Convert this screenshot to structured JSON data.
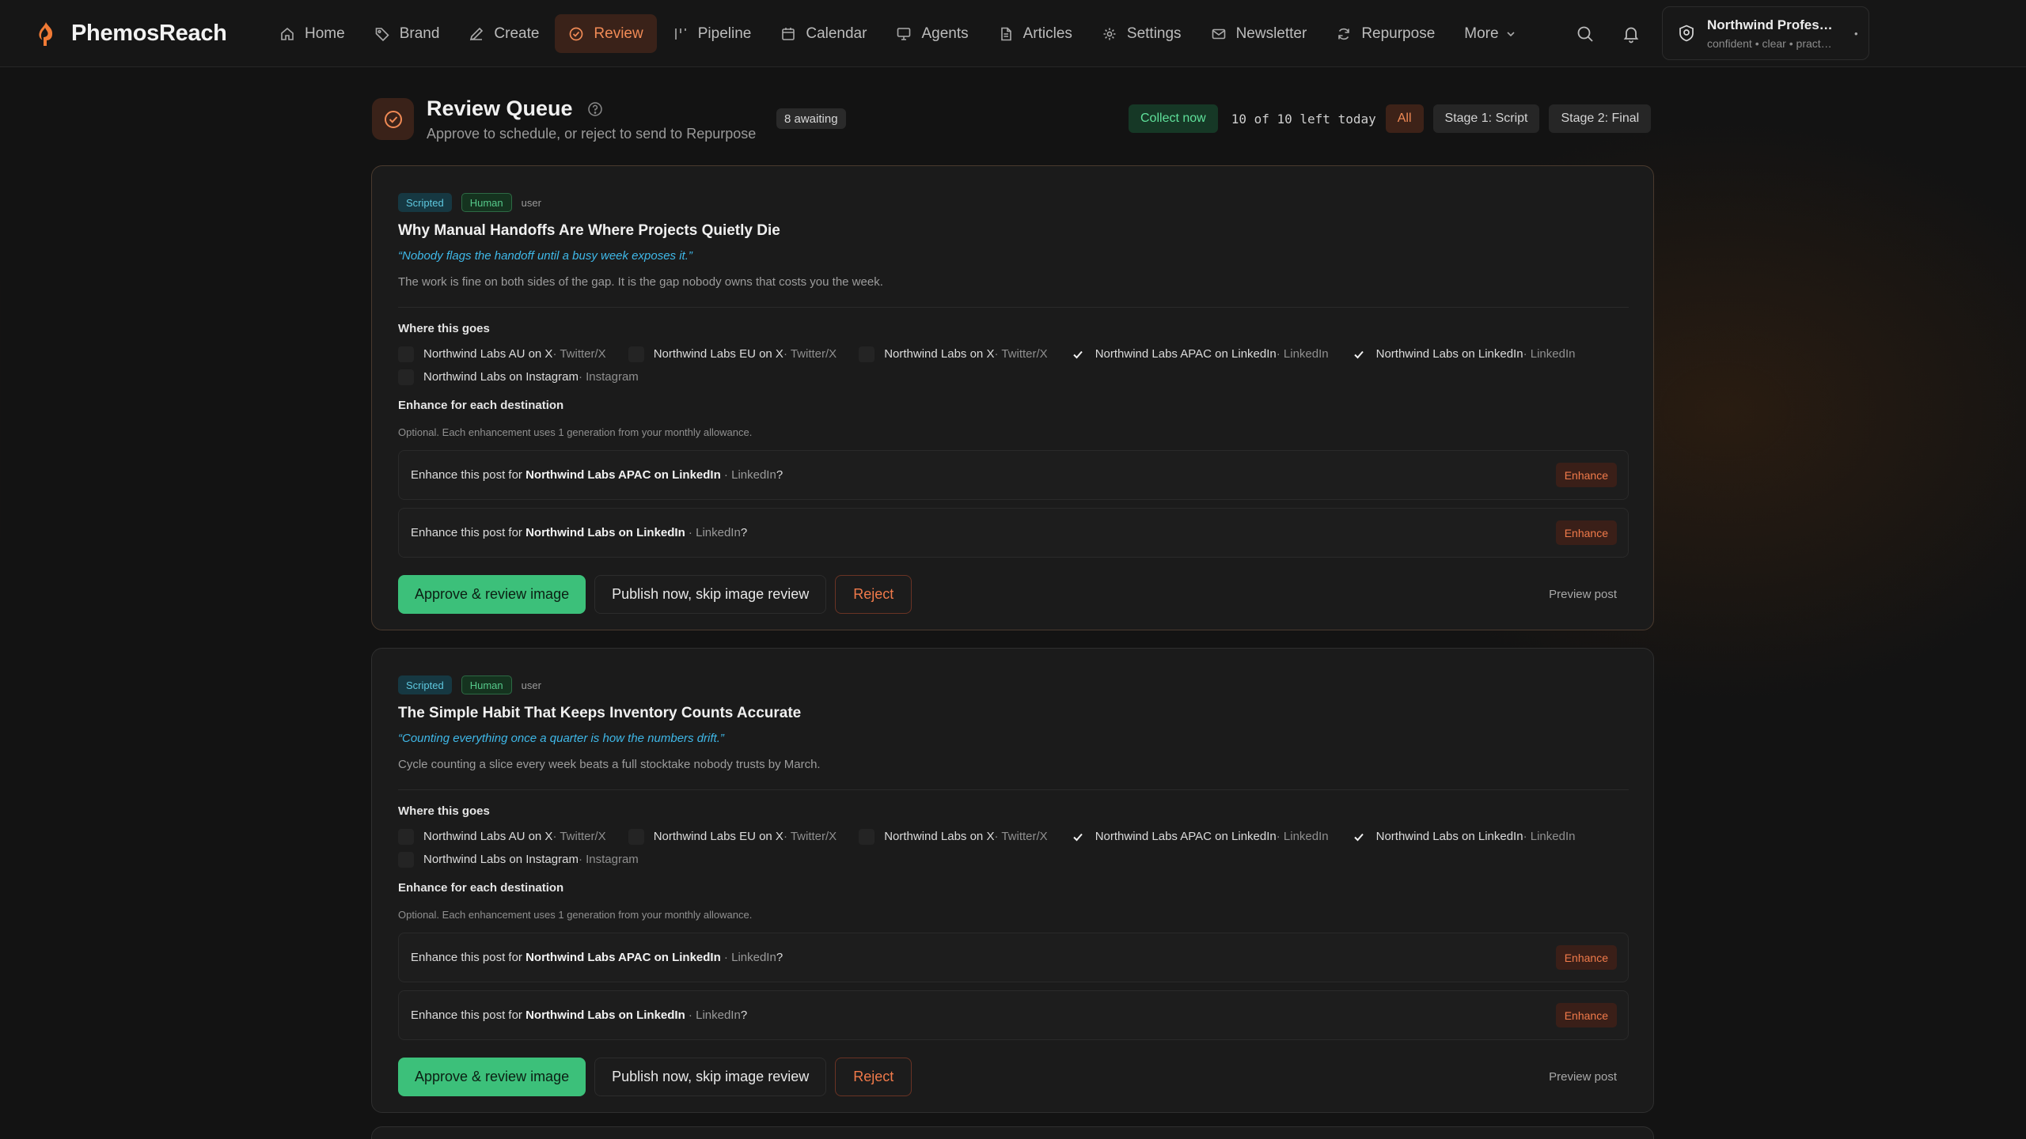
{
  "app": {
    "name": "PhemosReach",
    "brand_color": "#f08a55"
  },
  "nav": {
    "items": [
      {
        "label": "Home",
        "icon": "home-icon"
      },
      {
        "label": "Brand",
        "icon": "tag-icon"
      },
      {
        "label": "Create",
        "icon": "pen-icon"
      },
      {
        "label": "Review",
        "icon": "check-circle-icon",
        "active": true
      },
      {
        "label": "Pipeline",
        "icon": "pipeline-icon"
      },
      {
        "label": "Calendar",
        "icon": "calendar-icon"
      },
      {
        "label": "Agents",
        "icon": "monitor-icon"
      },
      {
        "label": "Articles",
        "icon": "document-icon"
      },
      {
        "label": "Settings",
        "icon": "gear-icon"
      },
      {
        "label": "Newsletter",
        "icon": "mail-icon"
      },
      {
        "label": "Repurpose",
        "icon": "refresh-icon"
      },
      {
        "label": "More",
        "icon": "chevron-down-icon"
      }
    ],
    "profile": {
      "name": "Northwind Profes…",
      "subtitle": "confident • clear • pract…",
      "dot": "•"
    }
  },
  "header": {
    "title": "Review Queue",
    "subtitle": "Approve to schedule, or reject to send to Repurpose",
    "awaiting": "8 awaiting",
    "collect": "Collect now",
    "left_today": "10 of 10 left today",
    "filters": [
      "All",
      "Stage 1: Script",
      "Stage 2: Final"
    ]
  },
  "labels": {
    "where": "Where this goes",
    "enhance_heading": "Enhance for each destination",
    "enhance_note": "Optional. Each enhancement uses 1 generation from your monthly allowance.",
    "enhance_prefix": "Enhance this post for ",
    "enhance_btn": "Enhance",
    "approve": "Approve & review image",
    "publish": "Publish now, skip image review",
    "reject": "Reject",
    "preview": "Preview post",
    "question": "?"
  },
  "cards": [
    {
      "tags": [
        "Scripted",
        "Human"
      ],
      "author": "user",
      "title": "Why Manual Handoffs Are Where Projects Quietly Die",
      "quote": "“Nobody flags the handoff until a busy week exposes it.”",
      "body": "The work is fine on both sides of the gap. It is the gap nobody owns that costs you the week.",
      "destinations": [
        {
          "name": "Northwind Labs AU on X",
          "platform": " · Twitter/X",
          "checked": false
        },
        {
          "name": "Northwind Labs EU on X",
          "platform": " · Twitter/X",
          "checked": false
        },
        {
          "name": "Northwind Labs on X",
          "platform": " · Twitter/X",
          "checked": false
        },
        {
          "name": "Northwind Labs APAC on LinkedIn",
          "platform": " · LinkedIn",
          "checked": true
        },
        {
          "name": "Northwind Labs on LinkedIn",
          "platform": " · LinkedIn",
          "checked": true
        },
        {
          "name": "Northwind Labs on Instagram",
          "platform": " · Instagram",
          "checked": false
        }
      ],
      "enhancements": [
        {
          "target": "Northwind Labs APAC on LinkedIn",
          "platform": " · LinkedIn"
        },
        {
          "target": "Northwind Labs on LinkedIn",
          "platform": " · LinkedIn"
        }
      ]
    },
    {
      "tags": [
        "Scripted",
        "Human"
      ],
      "author": "user",
      "title": "The Simple Habit That Keeps Inventory Counts Accurate",
      "quote": "“Counting everything once a quarter is how the numbers drift.”",
      "body": "Cycle counting a slice every week beats a full stocktake nobody trusts by March.",
      "destinations": [
        {
          "name": "Northwind Labs AU on X",
          "platform": " · Twitter/X",
          "checked": false
        },
        {
          "name": "Northwind Labs EU on X",
          "platform": " · Twitter/X",
          "checked": false
        },
        {
          "name": "Northwind Labs on X",
          "platform": " · Twitter/X",
          "checked": false
        },
        {
          "name": "Northwind Labs APAC on LinkedIn",
          "platform": " · LinkedIn",
          "checked": true
        },
        {
          "name": "Northwind Labs on LinkedIn",
          "platform": " · LinkedIn",
          "checked": true
        },
        {
          "name": "Northwind Labs on Instagram",
          "platform": " · Instagram",
          "checked": false
        }
      ],
      "enhancements": [
        {
          "target": "Northwind Labs APAC on LinkedIn",
          "platform": " · LinkedIn"
        },
        {
          "target": "Northwind Labs on LinkedIn",
          "platform": " · LinkedIn"
        }
      ]
    }
  ]
}
